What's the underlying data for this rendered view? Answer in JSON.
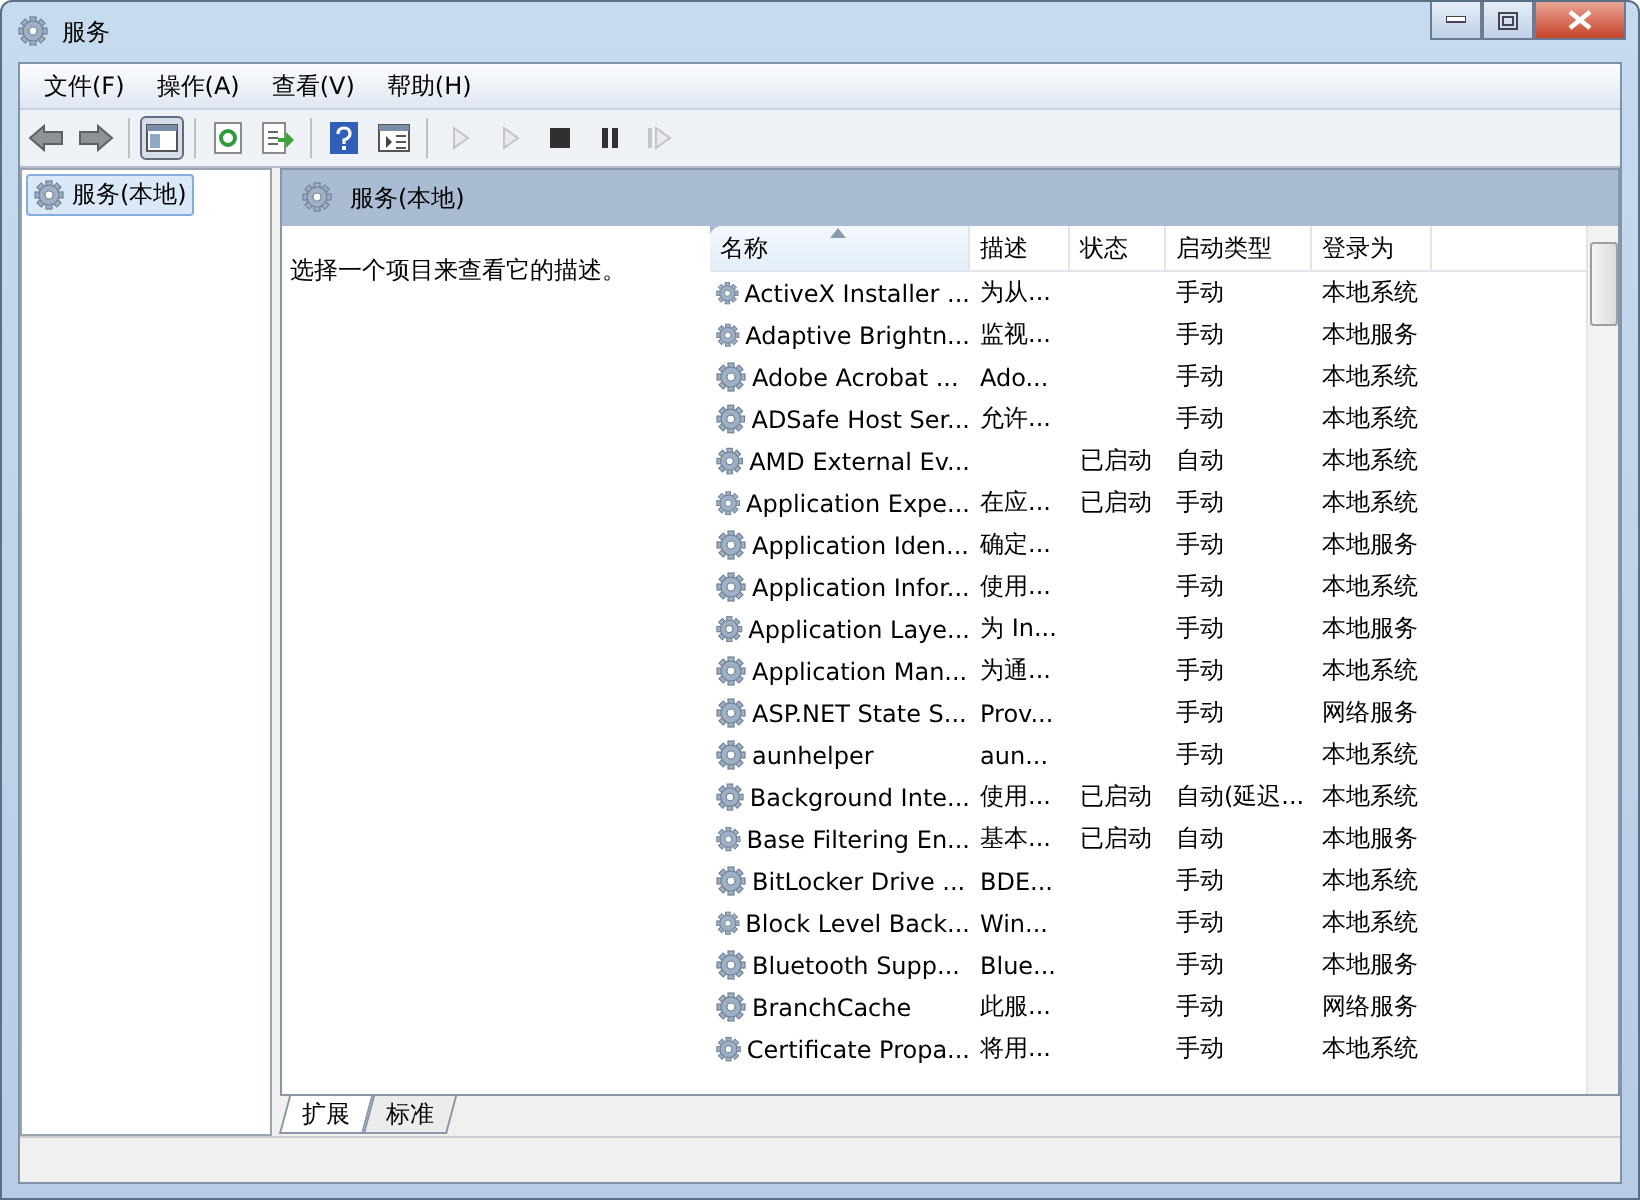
{
  "window": {
    "title": "服务"
  },
  "menu": [
    "文件(F)",
    "操作(A)",
    "查看(V)",
    "帮助(H)"
  ],
  "toolbar": [
    {
      "kind": "back",
      "disabled": false,
      "pressed": false
    },
    {
      "kind": "forward",
      "disabled": false,
      "pressed": false
    },
    {
      "kind": "sep"
    },
    {
      "kind": "tree",
      "disabled": false,
      "pressed": true
    },
    {
      "kind": "sep"
    },
    {
      "kind": "refresh",
      "disabled": false,
      "pressed": false
    },
    {
      "kind": "export",
      "disabled": false,
      "pressed": false
    },
    {
      "kind": "sep"
    },
    {
      "kind": "help",
      "disabled": false,
      "pressed": false
    },
    {
      "kind": "panel",
      "disabled": false,
      "pressed": false
    },
    {
      "kind": "sep"
    },
    {
      "kind": "play",
      "disabled": true,
      "pressed": false
    },
    {
      "kind": "play",
      "disabled": true,
      "pressed": false
    },
    {
      "kind": "stop",
      "disabled": false,
      "pressed": false
    },
    {
      "kind": "pause",
      "disabled": false,
      "pressed": false
    },
    {
      "kind": "resume",
      "disabled": true,
      "pressed": false
    }
  ],
  "tree": [
    {
      "label": "服务(本地)",
      "selected": true
    }
  ],
  "panel": {
    "title": "服务(本地)",
    "description": "选择一个项目来查看它的描述。"
  },
  "table": {
    "columns": [
      {
        "label": "名称",
        "sorted": true
      },
      {
        "label": "描述",
        "sorted": false
      },
      {
        "label": "状态",
        "sorted": false
      },
      {
        "label": "启动类型",
        "sorted": false
      },
      {
        "label": "登录为",
        "sorted": false
      }
    ],
    "rows": [
      {
        "name": "ActiveX Installer ...",
        "description": "为从...",
        "startup": "手动",
        "logon": "本地系统"
      },
      {
        "name": "Adaptive Brightn...",
        "description": "监视...",
        "startup": "手动",
        "logon": "本地服务"
      },
      {
        "name": "Adobe Acrobat ...",
        "description": "Ado...",
        "startup": "手动",
        "logon": "本地系统"
      },
      {
        "name": "ADSafe Host Ser...",
        "description": "允许...",
        "startup": "手动",
        "logon": "本地系统"
      },
      {
        "name": "AMD External Ev...",
        "status": "已启动",
        "startup": "自动",
        "logon": "本地系统"
      },
      {
        "name": "Application Expe...",
        "description": "在应...",
        "status": "已启动",
        "startup": "手动",
        "logon": "本地系统"
      },
      {
        "name": "Application Iden...",
        "description": "确定...",
        "startup": "手动",
        "logon": "本地服务"
      },
      {
        "name": "Application Infor...",
        "description": "使用...",
        "startup": "手动",
        "logon": "本地系统"
      },
      {
        "name": "Application Laye...",
        "description": "为 In...",
        "startup": "手动",
        "logon": "本地服务"
      },
      {
        "name": "Application Man...",
        "description": "为通...",
        "startup": "手动",
        "logon": "本地系统"
      },
      {
        "name": "ASP.NET State S...",
        "description": "Prov...",
        "startup": "手动",
        "logon": "网络服务"
      },
      {
        "name": "aunhelper",
        "description": "aun...",
        "startup": "手动",
        "logon": "本地系统"
      },
      {
        "name": "Background Inte...",
        "description": "使用...",
        "status": "已启动",
        "startup": "自动(延迟...",
        "logon": "本地系统"
      },
      {
        "name": "Base Filtering En...",
        "description": "基本...",
        "status": "已启动",
        "startup": "自动",
        "logon": "本地服务"
      },
      {
        "name": "BitLocker Drive ...",
        "description": "BDE...",
        "startup": "手动",
        "logon": "本地系统"
      },
      {
        "name": "Block Level Back...",
        "description": "Win...",
        "startup": "手动",
        "logon": "本地系统"
      },
      {
        "name": "Bluetooth Supp...",
        "description": "Blue...",
        "startup": "手动",
        "logon": "本地服务"
      },
      {
        "name": "BranchCache",
        "description": "此服...",
        "startup": "手动",
        "logon": "网络服务"
      },
      {
        "name": "Certificate Propa...",
        "description": "将用...",
        "startup": "手动",
        "logon": "本地系统"
      }
    ]
  },
  "tabs": [
    {
      "label": "扩展",
      "selected": true
    },
    {
      "label": "标准",
      "selected": false
    }
  ]
}
